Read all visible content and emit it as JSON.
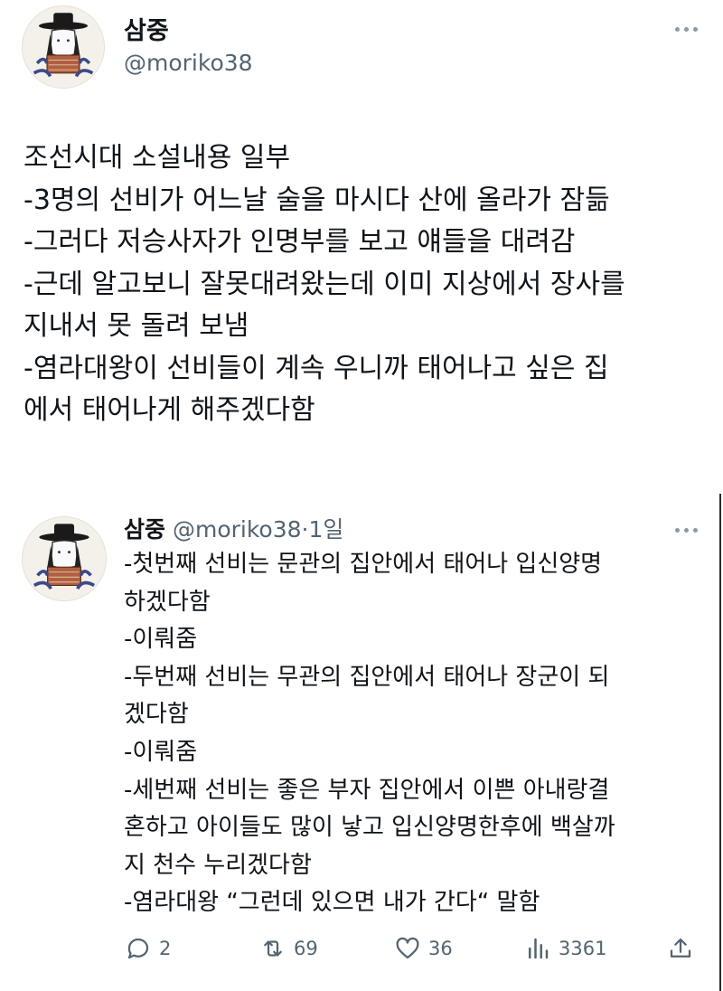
{
  "post1": {
    "display_name": "삼중",
    "handle": "@moriko38",
    "lines": [
      "조선시대 소설내용 일부",
      "-3명의 선비가 어느날 술을 마시다 산에 올라가 잠듦",
      "-그러다 저승사자가 인명부를 보고 얘들을 대려감",
      "-근데 알고보니 잘못대려왔는데 이미 지상에서 장사를",
      "지내서 못 돌려 보냄",
      "-염라대왕이 선비들이 계속 우니까 태어나고 싶은 집",
      "에서 태어나게 해주겠다함"
    ]
  },
  "post2": {
    "display_name": "삼중",
    "handle": "@moriko38",
    "separator": "·",
    "time": "1일",
    "lines": [
      "-첫번째 선비는 문관의 집안에서 태어나 입신양명",
      "하겠다함",
      "-이뤄줌",
      "-두번째 선비는 무관의 집안에서 태어나 장군이 되",
      "겠다함",
      "-이뤄줌",
      "-세번째 선비는 좋은 부자 집안에서 이쁜 아내랑결",
      "혼하고 아이들도 많이 낳고 입신양명한후에 백살까",
      "지 천수 누리겠다함",
      "-염라대왕 “그런데 있으면 내가 간다“ 말함"
    ],
    "actions": {
      "replies": "2",
      "retweets": "69",
      "likes": "36",
      "views": "3361"
    }
  },
  "icons": [
    "more-icon",
    "reply-icon",
    "retweet-icon",
    "like-icon",
    "views-icon",
    "share-icon"
  ],
  "colors": {
    "text": "#0f1419",
    "secondary": "#536471",
    "background": "#ffffff"
  }
}
